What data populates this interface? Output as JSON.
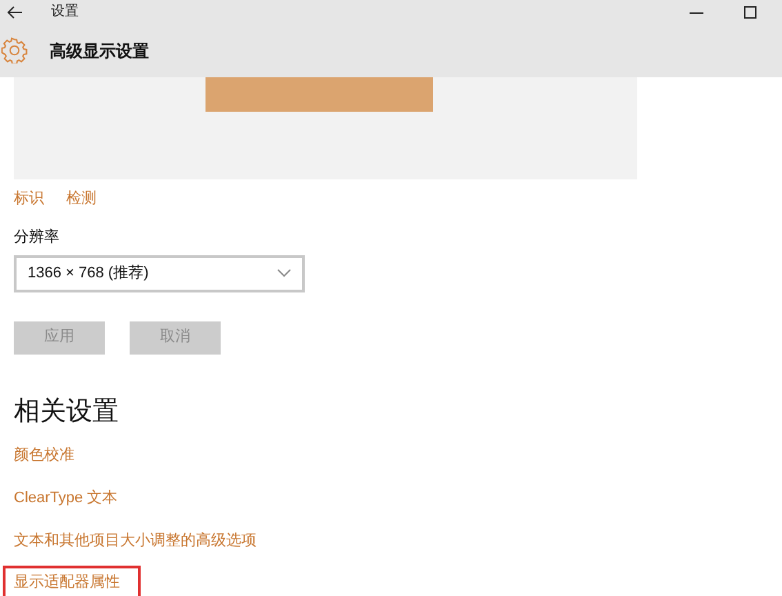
{
  "window": {
    "title": "设置"
  },
  "header": {
    "title": "高级显示设置"
  },
  "display_links": [
    {
      "label": "标识"
    },
    {
      "label": "检测"
    }
  ],
  "resolution": {
    "label": "分辨率",
    "value": "1366 × 768 (推荐)"
  },
  "buttons": [
    {
      "label": "应用",
      "disabled": true
    },
    {
      "label": "取消",
      "disabled": true
    }
  ],
  "related": {
    "heading": "相关设置",
    "links": [
      {
        "label": "颜色校准",
        "highlighted": false
      },
      {
        "label": "ClearType 文本",
        "highlighted": false
      },
      {
        "label": "文本和其他项目大小调整的高级选项",
        "highlighted": false
      },
      {
        "label": "显示适配器属性",
        "highlighted": true
      }
    ]
  }
}
